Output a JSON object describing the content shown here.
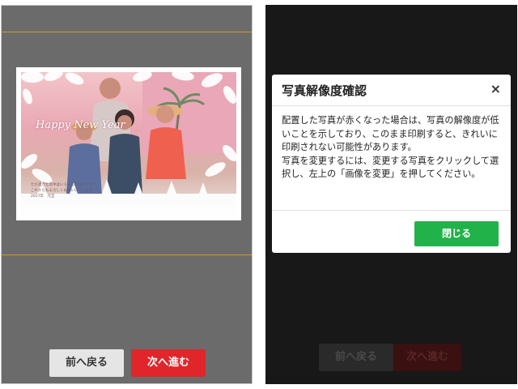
{
  "left_screen": {
    "card": {
      "greeting": "Happy New Year",
      "message_lines": [
        "ただ過ぎた年中はいろいろのおかげです",
        "これからもよろしくお願いいたします",
        "2017年　元旦"
      ]
    },
    "buttons": {
      "back_label": "前へ戻る",
      "next_label": "次へ進む"
    }
  },
  "right_screen": {
    "modal": {
      "title": "写真解像度確認",
      "close_symbol": "×",
      "body_paragraph_1": "配置した写真が赤くなった場合は、写真の解像度が低いことを示しており、このまま印刷すると、きれいに印刷されない可能性があります。",
      "body_paragraph_2": "写真を変更するには、変更する写真をクリックして選択し、左上の「画像を変更」を押してください。",
      "close_button_label": "閉じる"
    },
    "buttons": {
      "back_label": "前へ戻る",
      "next_label": "次へ進む"
    }
  },
  "colors": {
    "guide_line": "#d29b2d",
    "next_button": "#e0262b",
    "close_button": "#21b24a"
  }
}
